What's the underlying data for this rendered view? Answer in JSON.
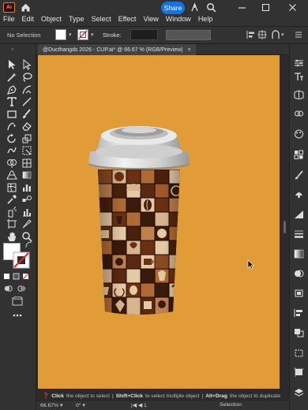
{
  "app": {
    "logo": "Ai"
  },
  "menu": [
    "File",
    "Edit",
    "Object",
    "Type",
    "Select",
    "Effect",
    "View",
    "Window",
    "Help"
  ],
  "share": {
    "label": "Share"
  },
  "control": {
    "selection": "No Selection",
    "stroke_label": "Stroke:"
  },
  "document": {
    "tab_title": "@Ducthangds 2026 - CUP.ai* @ 66.67 % (RGB/Preview)",
    "close": "×"
  },
  "colors": {
    "artboard": "#e19b37",
    "accent": "#1473e6",
    "ui": "#323232"
  },
  "hint": {
    "parts": [
      {
        "b": "Click",
        "t": " the object to select"
      },
      {
        "b": "Shift+Click",
        "t": " to select multiple object"
      },
      {
        "b": "Alt+Drag",
        "t": " the object to duplicate"
      }
    ]
  },
  "status": {
    "zoom": "66.67%",
    "rotation": "0°",
    "page": "1",
    "tool": "Selection"
  }
}
